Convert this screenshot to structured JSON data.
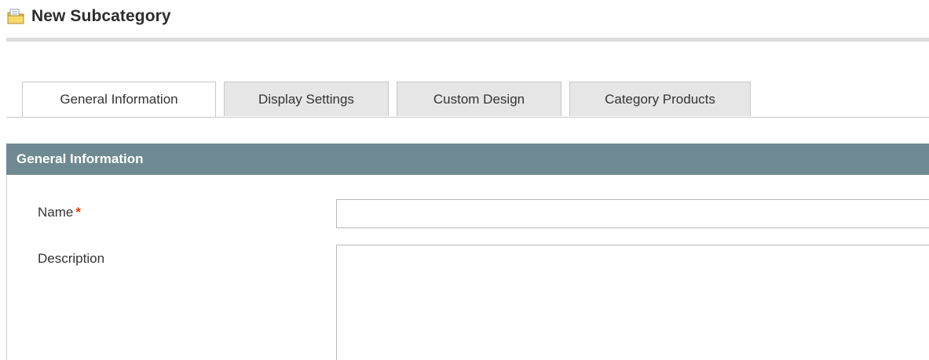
{
  "header": {
    "title": "New Subcategory",
    "icon": "folder-icon"
  },
  "tabs": [
    {
      "label": "General Information",
      "active": true
    },
    {
      "label": "Display Settings",
      "active": false
    },
    {
      "label": "Custom Design",
      "active": false
    },
    {
      "label": "Category Products",
      "active": false
    }
  ],
  "section": {
    "title": "General Information",
    "fields": {
      "name": {
        "label": "Name",
        "required_mark": "*",
        "value": ""
      },
      "description": {
        "label": "Description",
        "value": ""
      }
    }
  },
  "colors": {
    "section_header": "#6f8992",
    "required": "#eb340a",
    "tab_inactive": "#e6e6e6"
  }
}
